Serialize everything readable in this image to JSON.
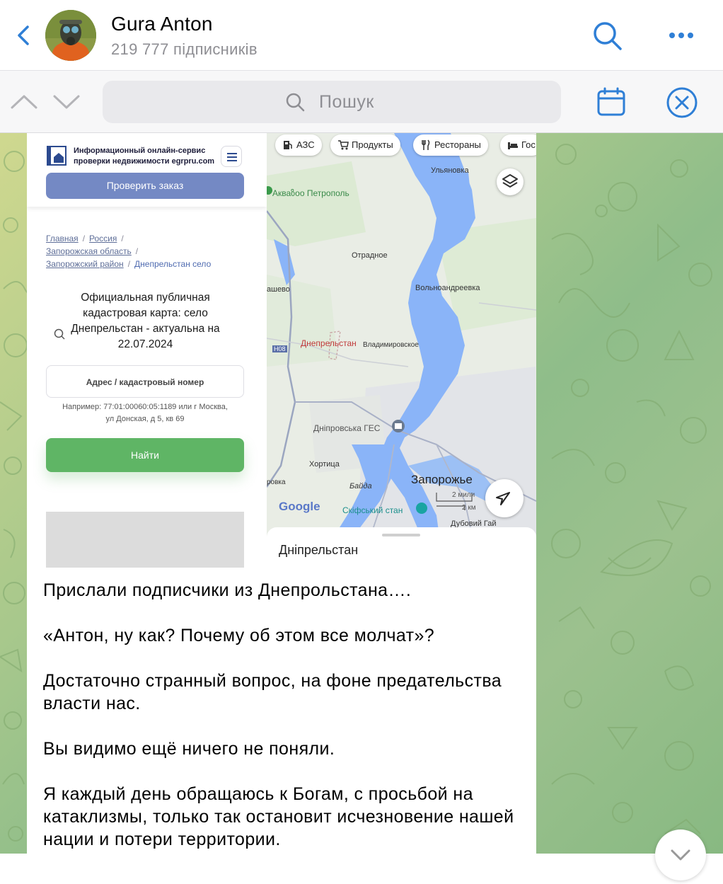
{
  "header": {
    "channel_title": "Gura Anton",
    "subscribers": "219 777 підписників",
    "icons": {
      "back": "chevron-left-icon",
      "search": "search-icon",
      "more": "more-dots-icon"
    },
    "accent_color": "#2f7fd6"
  },
  "search_bar": {
    "placeholder": "Пошук",
    "icons": {
      "up": "chevron-up-icon",
      "down": "chevron-down-icon",
      "calendar": "calendar-icon",
      "close": "close-circle-icon"
    }
  },
  "left_screenshot": {
    "site_name": "Информационный онлайн-сервис проверки недвижимости egrpru.com",
    "check_order_button": "Проверить заказ",
    "breadcrumb": {
      "home": "Главная",
      "country": "Россия",
      "region": "Запорожская область",
      "district": "Запорожский район",
      "current": "Днепрельстан село"
    },
    "heading": "Официальная публичная кадастровая карта: село Днепрельстан - актуальна на 22.07.2024",
    "address_input_placeholder": "Адрес / кадастровый номер",
    "example": "Например: 77:01:00060:05:1189 или г Москва, ул Донская, д 5, кв 69",
    "find_button": "Найти",
    "colors": {
      "check_button": "#7489c4",
      "find_button": "#5fb565"
    }
  },
  "map_screenshot": {
    "chips": [
      "АЗС",
      "Продукты",
      "Рестораны",
      "Гос"
    ],
    "labels": {
      "ulyanovka": "Ульяновка",
      "akvazoo": "Акваზоо Петрополь",
      "otradnoe": "Отрадное",
      "shevo": "ашево",
      "volnoandreevka": "Вольноандреевка",
      "dneprelstan": "Днепрельстан",
      "vladimirovskoe": "Владимировское",
      "road": "Н08",
      "dniprovska_ges": "Дніпровська ГЕС",
      "khortytsa": "Хортица",
      "bayda": "Байда",
      "zaporozhye": "Запорожье",
      "ovka": "ровка",
      "skifskiy": "Скіфський стан",
      "dubovyi": "Дубовий Гай",
      "scale_miles": "2 мили",
      "scale_km": "2 км",
      "google": "Google"
    },
    "sheet_title": "Дніпрельстан",
    "icons": {
      "layers": "layers-icon",
      "locate": "navigation-arrow-icon"
    },
    "colors": {
      "water": "#8ab4f8",
      "land": "#e9ede5",
      "urban": "#dfe2e6"
    }
  },
  "message": {
    "paragraphs": [
      "Прислали подписчики из Днепрольстана….",
      "«Антон, ну как? Почему об этом все молчат»?",
      "Достаточно странный вопрос, на фоне предательства власти нас.",
      "Вы видимо ещё ничего не поняли.",
      "Я каждый день обращаюсь к Богам, с просьбой на катаклизмы, только так остановит исчезновение нашей нации и потери территории."
    ]
  },
  "scroll_down": {
    "icon": "chevron-down-icon"
  }
}
